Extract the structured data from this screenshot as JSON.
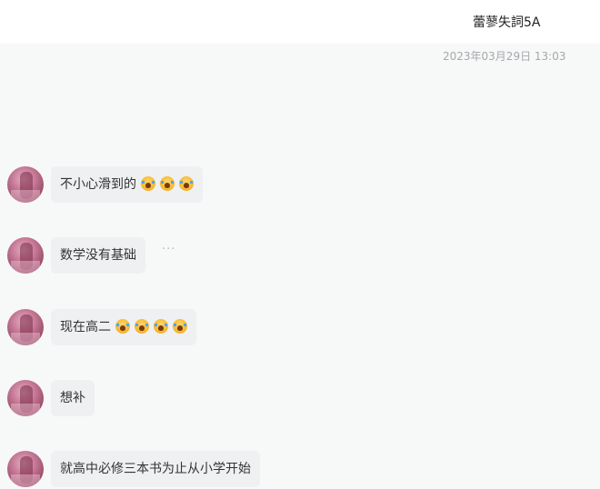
{
  "header": {
    "title": "蕾蓼失詞5A"
  },
  "timestamp": "2023年03月29日 13:03",
  "messages": [
    {
      "text": "不小心滑到的",
      "emoji_count": 3,
      "emoji_icon": "loudly-crying-face-icon"
    },
    {
      "text": "数学没有基础",
      "emoji_count": 0,
      "more": "···"
    },
    {
      "text": "现在高二",
      "emoji_count": 4,
      "emoji_icon": "loudly-crying-face-icon"
    },
    {
      "text": "想补",
      "emoji_count": 0
    },
    {
      "text": "就高中必修三本书为止从小学开始",
      "emoji_count": 0
    }
  ]
}
